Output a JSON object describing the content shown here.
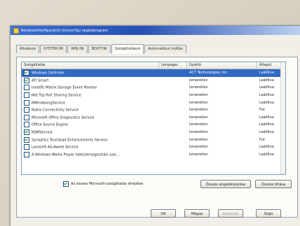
{
  "window": {
    "title": "Rendszerkonfiguráció (msconfig) segédprogram"
  },
  "tabs": [
    "Általános",
    "SYSTEM.INI",
    "WIN.INI",
    "BOOT.INI",
    "Szolgáltatások",
    "Automatikus indítás"
  ],
  "active_tab": 4,
  "columns": [
    "Szolgáltatás",
    "Lényeges",
    "Gyártó",
    "Állapot"
  ],
  "services": [
    {
      "checked": true,
      "name": "Windows Defender",
      "essential": "",
      "vendor": "ACT Technologies, Inc.",
      "status": "Leállítva",
      "selected": true
    },
    {
      "checked": true,
      "name": "ATI Smart",
      "essential": "",
      "vendor": "Ismeretlen",
      "status": "Leállítva"
    },
    {
      "checked": false,
      "name": "Intel(R) Matrix Storage Event Monitor",
      "essential": "",
      "vendor": "Ismeretlen",
      "status": "Leállítva"
    },
    {
      "checked": false,
      "name": "Net.Tcp Port Sharing Service",
      "essential": "",
      "vendor": "Ismeretlen",
      "status": "Leállítva"
    },
    {
      "checked": false,
      "name": "NMIndexingService",
      "essential": "",
      "vendor": "Ismeretlen",
      "status": "Leállítva"
    },
    {
      "checked": false,
      "name": "Nokia Connectivity Service",
      "essential": "",
      "vendor": "Ismeretlen",
      "status": "Fut"
    },
    {
      "checked": false,
      "name": "Microsoft Office Diagnostics Service",
      "essential": "",
      "vendor": "Ismeretlen",
      "status": "Leállítva"
    },
    {
      "checked": false,
      "name": "Office Source Engine",
      "essential": "",
      "vendor": "Ismeretlen",
      "status": "Leállítva"
    },
    {
      "checked": true,
      "name": "NSMService",
      "essential": "",
      "vendor": "Ismeretlen",
      "status": "Leállítva"
    },
    {
      "checked": true,
      "name": "Synaptics Touchpad Enhancements Service",
      "essential": "",
      "vendor": "Ismeretlen",
      "status": "Fut"
    },
    {
      "checked": false,
      "name": "Lavasoft Ad-Aware Service",
      "essential": "",
      "vendor": "Ismeretlen",
      "status": "Leállítva"
    },
    {
      "checked": false,
      "name": "A Windows Media Player hálózatmegosztási szol...",
      "essential": "",
      "vendor": "Ismeretlen",
      "status": "Leállítva"
    }
  ],
  "hide_ms_label": "Az összes Microsoft szolgáltatás elrejtése",
  "hide_ms_checked": true,
  "buttons": {
    "enable_all": "Összes engedélyezése",
    "disable_all": "Összes tiltása",
    "ok": "OK",
    "cancel": "Mégse",
    "apply": "Alkalmaz",
    "help": "Súgó"
  },
  "colors": {
    "selection": "#316ac5",
    "titlebar": "#2550b4"
  }
}
